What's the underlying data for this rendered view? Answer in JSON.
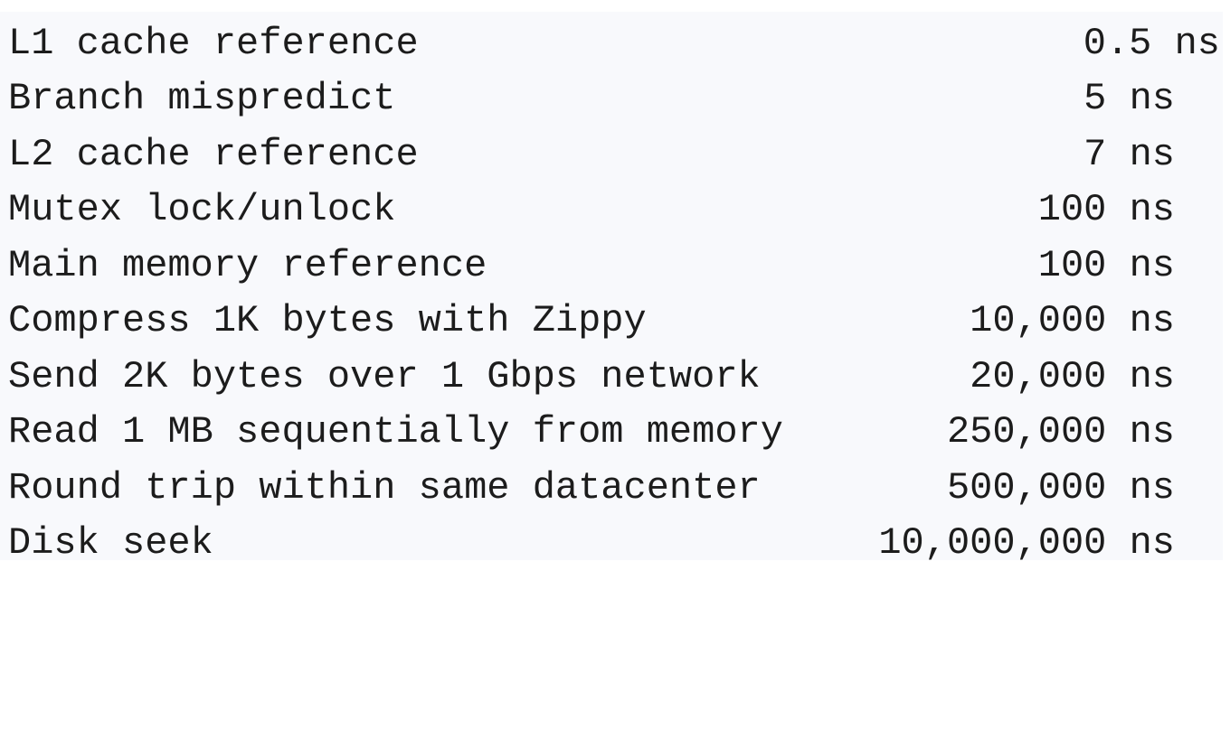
{
  "latency_table": {
    "rows": [
      {
        "label": "L1 cache reference",
        "value": "0.5 ns"
      },
      {
        "label": "Branch mispredict",
        "value": "5 ns"
      },
      {
        "label": "L2 cache reference",
        "value": "7 ns"
      },
      {
        "label": "Mutex lock/unlock",
        "value": "100 ns"
      },
      {
        "label": "Main memory reference",
        "value": "100 ns"
      },
      {
        "label": "Compress 1K bytes with Zippy",
        "value": "10,000 ns"
      },
      {
        "label": "Send 2K bytes over 1 Gbps network",
        "value": "20,000 ns"
      },
      {
        "label": "Read 1 MB sequentially from memory",
        "value": "250,000 ns"
      },
      {
        "label": "Round trip within same datacenter",
        "value": "500,000 ns"
      },
      {
        "label": "Disk seek",
        "value": "10,000,000 ns"
      }
    ]
  }
}
